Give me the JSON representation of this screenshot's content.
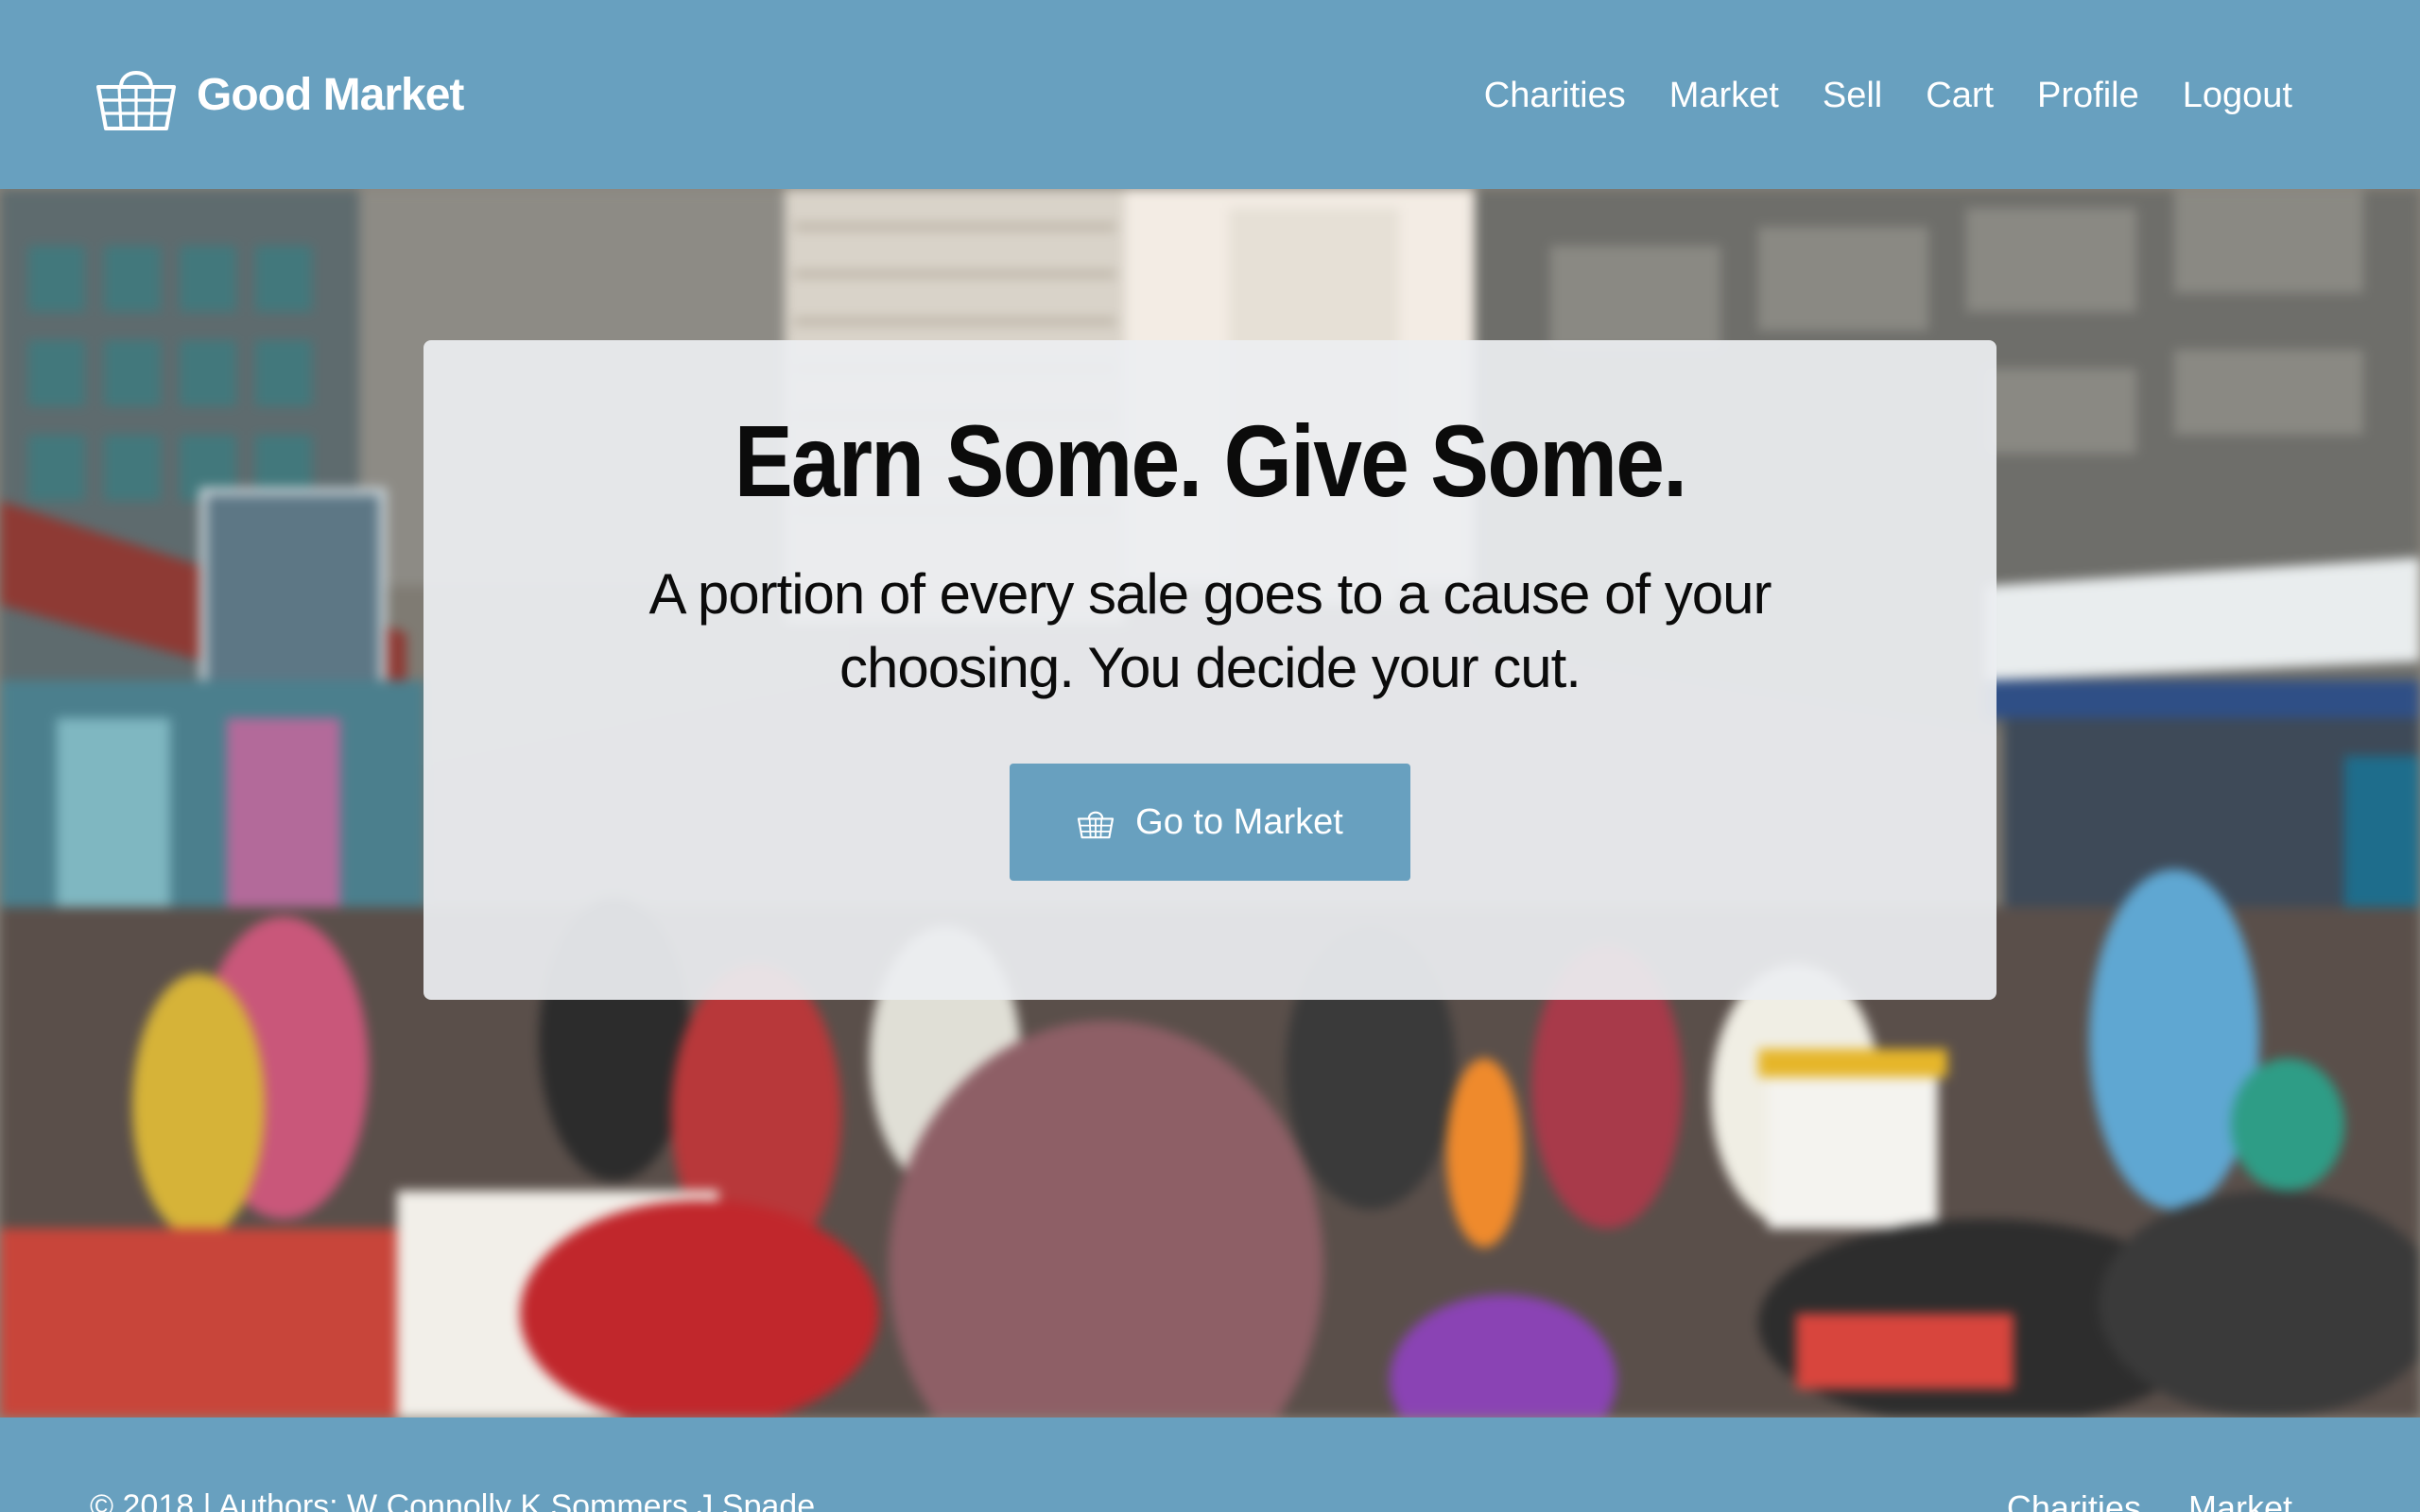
{
  "header": {
    "brand_name": "Good Market",
    "brand_icon": "basket-icon",
    "nav": [
      {
        "label": "Charities"
      },
      {
        "label": "Market"
      },
      {
        "label": "Sell"
      },
      {
        "label": "Cart"
      },
      {
        "label": "Profile"
      },
      {
        "label": "Logout"
      }
    ]
  },
  "hero": {
    "headline": "Earn Some. Give Some.",
    "subheading": "A portion of every sale goes to a cause of your choosing. You decide your cut.",
    "cta_label": "Go to Market",
    "cta_icon": "basket-icon"
  },
  "footer": {
    "copyright": "© 2018 | Authors: W Connolly K Sommers J Spade",
    "links": [
      {
        "label": "Charities"
      },
      {
        "label": "Market"
      }
    ]
  },
  "colors": {
    "primary": "#68a0bf",
    "card_background": "#eceef1",
    "text_dark": "#0b0b0b",
    "text_light": "#ffffff"
  }
}
